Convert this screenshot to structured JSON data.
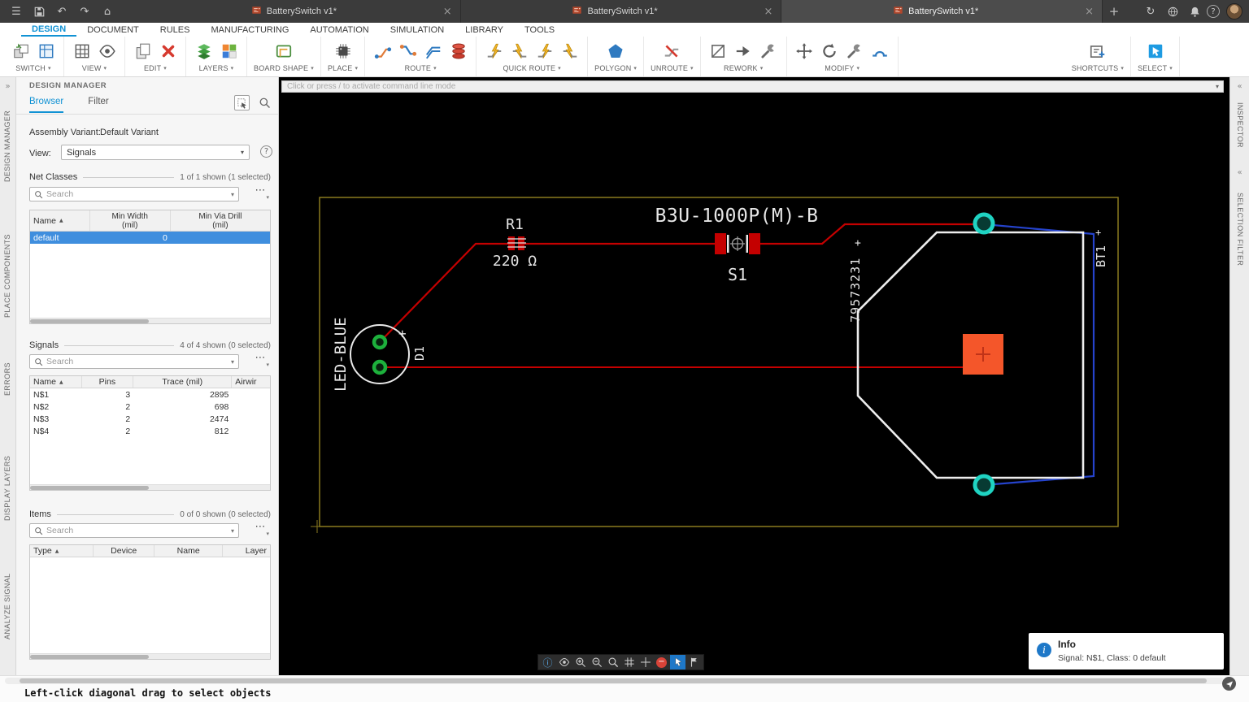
{
  "colors": {
    "accent_blue": "#1192d4",
    "selected_row_blue": "#3f8ede",
    "trace_red": "#c40000",
    "route_blue": "#2543cc",
    "silkscreen_white": "#ededed",
    "board_outline_olive": "#8a7a1f",
    "pad_green": "#1db13c",
    "pad_teal": "#1fd3c2",
    "pad_orange": "#f4562a",
    "delete_red": "#d63a2f",
    "canvas_black": "#000000"
  },
  "icons": {
    "hamburger": "☰",
    "undo": "↶",
    "redo": "↷",
    "home": "⌂",
    "sync": "↻",
    "close": "×",
    "plus": "+",
    "caret_down": "▾",
    "sort_asc": "▲",
    "more": "⋯",
    "help": "?",
    "chevrons_right": "»",
    "chevrons_left": "«",
    "minus": "−",
    "info_circled": "ⓘ",
    "info_i": "i"
  },
  "titlebar": {
    "tabs": [
      {
        "label": "BatterySwitch v1*"
      },
      {
        "label": "BatterySwitch v1*"
      },
      {
        "label": "BatterySwitch v1*"
      }
    ]
  },
  "menubar": {
    "items": [
      {
        "label": "DESIGN"
      },
      {
        "label": "DOCUMENT"
      },
      {
        "label": "RULES"
      },
      {
        "label": "MANUFACTURING"
      },
      {
        "label": "AUTOMATION"
      },
      {
        "label": "SIMULATION"
      },
      {
        "label": "LIBRARY"
      },
      {
        "label": "TOOLS"
      }
    ]
  },
  "toolbar": {
    "groups": [
      {
        "label": "SWITCH"
      },
      {
        "label": "VIEW"
      },
      {
        "label": "EDIT"
      },
      {
        "label": "LAYERS"
      },
      {
        "label": "BOARD SHAPE"
      },
      {
        "label": "PLACE"
      },
      {
        "label": "ROUTE"
      },
      {
        "label": "QUICK ROUTE"
      },
      {
        "label": "POLYGON"
      },
      {
        "label": "UNROUTE"
      },
      {
        "label": "REWORK"
      },
      {
        "label": "MODIFY"
      },
      {
        "label": "SHORTCUTS"
      },
      {
        "label": "SELECT"
      }
    ]
  },
  "command_line": {
    "placeholder": "Click or press / to activate command line mode"
  },
  "left_rail": {
    "items": [
      "DESIGN MANAGER",
      "PLACE COMPONENTS",
      "ERRORS",
      "DISPLAY LAYERS",
      "ANALYZE SIGNAL"
    ]
  },
  "right_rail": {
    "items": [
      "INSPECTOR",
      "SELECTION FILTER"
    ]
  },
  "design_manager": {
    "title": "DESIGN MANAGER",
    "tabs": [
      {
        "label": "Browser"
      },
      {
        "label": "Filter"
      }
    ],
    "assembly_variant_label": "Assembly Variant:",
    "assembly_variant_value": "Default Variant",
    "view_label": "View:",
    "view_value": "Signals",
    "net_classes": {
      "label": "Net Classes",
      "summary": "1 of 1 shown (1 selected)",
      "search_placeholder": "Search",
      "columns": {
        "name": "Name",
        "min_width": "Min Width",
        "min_via_drill": "Min Via Drill",
        "unit": "(mil)"
      },
      "rows": [
        {
          "name": "default",
          "min_width": "0",
          "min_via_drill": ""
        }
      ]
    },
    "signals": {
      "label": "Signals",
      "summary": "4 of 4 shown (0 selected)",
      "search_placeholder": "Search",
      "columns": {
        "name": "Name",
        "pins": "Pins",
        "trace": "Trace (mil)",
        "airwires": "Airwir"
      },
      "rows": [
        {
          "name": "N$1",
          "pins": "3",
          "trace": "2895",
          "airwires": ""
        },
        {
          "name": "N$2",
          "pins": "2",
          "trace": "698",
          "airwires": ""
        },
        {
          "name": "N$3",
          "pins": "2",
          "trace": "2474",
          "airwires": ""
        },
        {
          "name": "N$4",
          "pins": "2",
          "trace": "812",
          "airwires": ""
        }
      ]
    },
    "items": {
      "label": "Items",
      "summary": "0 of 0 shown (0 selected)",
      "search_placeholder": "Search",
      "columns": {
        "type": "Type",
        "device": "Device",
        "name": "Name",
        "layer": "Layer"
      },
      "rows": []
    }
  },
  "board": {
    "part_title": "B3U-1000P(M)-B",
    "r1_ref": "R1",
    "r1_value": "220 Ω",
    "s1_ref": "S1",
    "led_name": "LED-BLUE",
    "d1_ref": "D1",
    "led_plus": "+",
    "bt_part_number": "79573231",
    "bt_plus": "+",
    "bt1_ref": "BT1",
    "bt1_plus": "+"
  },
  "info_popup": {
    "title": "Info",
    "detail": "Signal: N$1, Class: 0 default"
  },
  "status_bar": {
    "text": "Left-click diagonal drag to select objects"
  }
}
